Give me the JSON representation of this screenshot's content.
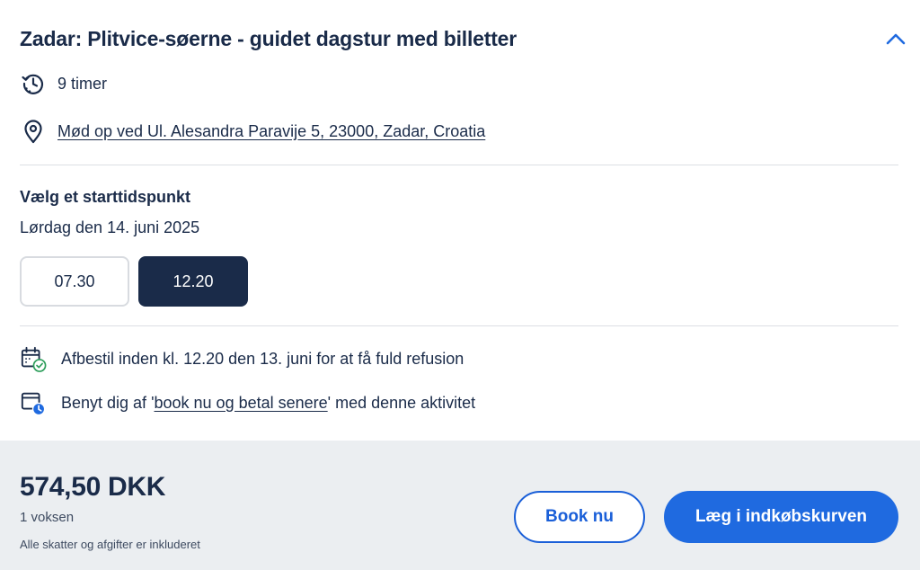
{
  "activity": {
    "title": "Zadar: Plitvice-søerne - guidet dagstur med billetter",
    "duration": "9 timer",
    "meeting_point": "Mød op ved Ul. Alesandra Paravije 5, 23000, Zadar, Croatia"
  },
  "time_picker": {
    "label": "Vælg et starttidspunkt",
    "date": "Lørdag den 14. juni 2025",
    "slots": [
      {
        "label": "07.30",
        "selected": false
      },
      {
        "label": "12.20",
        "selected": true
      }
    ]
  },
  "policies": {
    "cancellation": "Afbestil inden kl. 12.20 den 13. juni for at få fuld refusion",
    "book_later_prefix": "Benyt dig af '",
    "book_later_link": "book nu og betal senere",
    "book_later_suffix": "' med denne aktivitet"
  },
  "footer": {
    "price": "574,50 DKK",
    "participants": "1 voksen",
    "taxes_note": "Alle skatter og afgifter er inkluderet",
    "book_now_label": "Book nu",
    "add_to_cart_label": "Læg i indkøbskurven"
  },
  "icons": {
    "collapse": "chevron-up-icon",
    "duration": "clock-history-icon",
    "location": "location-pin-icon",
    "cancellation": "calendar-check-icon",
    "book_later": "calendar-clock-icon"
  },
  "colors": {
    "text": "#1a2b49",
    "accent": "#1f6ae0",
    "selected_slot": "#1a2b49",
    "footer_bg": "#ebeef1",
    "success": "#2e9e5b"
  }
}
